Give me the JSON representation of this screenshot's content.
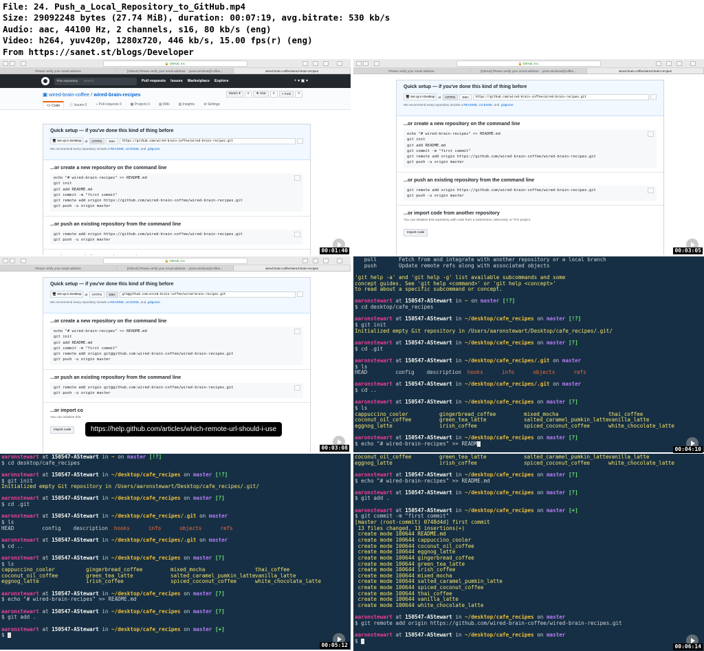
{
  "header": {
    "lines": [
      "File: 24. Push_a_Local_Repository_to_GitHub.mp4",
      "Size: 29092248 bytes (27.74 MiB), duration: 00:07:19, avg.bitrate: 530 kb/s",
      "Audio: aac, 44100 Hz, 2 channels, s16, 80 kb/s (eng)",
      "Video: h264, yuv420p, 1280x720, 446 kb/s, 15.00 fps(r) (eng)",
      "From https://sanet.st/blogs/Developer"
    ]
  },
  "timestamps": [
    "00:01:40",
    "00:03:05",
    "00:03:08",
    "00:04:10",
    "00:05:12",
    "00:06:14"
  ],
  "browser": {
    "address": "GitHub, Inc.",
    "tabs": [
      "Please verify your email address",
      "[GitHub] Please verify your email address. - jones.winslow@coffee...",
      "wired-brain-coffee/wired-brain-recipes"
    ],
    "nav": {
      "this_repo": "This repository",
      "search": "Search",
      "links": [
        "Pull requests",
        "Issues",
        "Marketplace",
        "Explore"
      ],
      "right": "+ ▾  ▣ ▾"
    },
    "repo": {
      "owner": "wired-brain-coffee",
      "sep": " / ",
      "name": "wired-brain-recipes",
      "watch": "Watch ▾",
      "watch_n": "0",
      "star": "★ Star",
      "star_n": "0",
      "fork": "⑂ Fork",
      "fork_n": "0"
    },
    "repo_tabs": [
      "<> Code",
      "ⓘ Issues 0",
      "⑂ Pull requests 0",
      "▦ Projects 0",
      "▤ Wiki",
      "▥ Insights",
      "⚙ Settings"
    ],
    "qs_title": "Quick setup — if you've done this kind of thing before",
    "setup_desktop": "🖥 Set up in Desktop",
    "or": "or",
    "https": "HTTPS",
    "ssh": "SSH",
    "url_https": "https://github.com/wired-brain-coffee/wired-brain-recipes.git",
    "url_ssh": "git@github.com:wired-brain-coffee/wired-brain-recipes.git",
    "recommend": [
      "We recommend every repository include a ",
      "README",
      ", ",
      "LICENSE",
      ", and ",
      ".gitignore",
      "."
    ],
    "create_title": "...or create a new repository on the command line",
    "create_https": [
      "echo \"# wired-brain-recipes\" >> README.md",
      "git init",
      "git add README.md",
      "git commit -m \"first commit\"",
      "git remote add origin https://github.com/wired-brain-coffee/wired-brain-recipes.git",
      "git push -u origin master"
    ],
    "create_ssh": [
      "echo \"# wired-brain-recipes\" >> README.md",
      "git init",
      "git add README.md",
      "git commit -m \"first commit\"",
      "git remote add origin git@github.com:wired-brain-coffee/wired-brain-recipes.git",
      "git push -u origin master"
    ],
    "push_title": "...or push an existing repository from the command line",
    "push_https": [
      "git remote add origin https://github.com/wired-brain-coffee/wired-brain-recipes.git",
      "git push -u origin master"
    ],
    "push_ssh": [
      "git remote add origin git@github.com:wired-brain-coffee/wired-brain-recipes.git",
      "git push -u origin master"
    ],
    "import_title": "...or import code from another repository",
    "import_title_cut": "...or import co",
    "import_desc": "You can initialize this repository with code from a Subversion, Mercurial, or TFS project.",
    "import_desc_cut": "You can initialize this",
    "import_btn": "Import code",
    "tooltip": "https://help.github.com/articles/which-remote-url-should-i-use"
  },
  "terminal": {
    "user": "aaronstewart",
    "at": " at ",
    "host": "150547-AStewart",
    "in": " in ",
    "on": " on ",
    "branch": "master",
    "help_pull": "   pull       Fetch from and integrate with another repository or a local branch",
    "help_push": "   push       Update remote refs along with associated objects",
    "help_tail": [
      "'git help -a' and 'git help -g' list available subcommands and some",
      "concept guides. See 'git help <command>' or 'git help <concept>'",
      "to read about a specific subcommand or concept."
    ],
    "init_out": "Initialized empty Git repository in /Users/aaronstewart/Desktop/cafe_recipes/.git/",
    "git_ls": [
      "HEAD",
      "config",
      "description",
      "hooks",
      "info",
      "objects",
      "refs"
    ],
    "ls_rows": [
      [
        "cappuccino_cooler",
        "gingerbread_coffee",
        "mixed_mocha",
        "thai_coffee"
      ],
      [
        "coconut_oil_coffee",
        "green_tea_latte",
        "salted_caramel_pumkin_latte",
        "vanilla_latte"
      ],
      [
        "eggnog_latte",
        "irish_coffee",
        "spiced_coconut_coffee",
        "white_chocolate_latte"
      ]
    ],
    "commit_out": [
      "[master (root-commit) 0748d4d] first commit",
      " 13 files changed, 13 insertions(+)",
      " create mode 100644 README.md",
      " create mode 100644 cappuccino_cooler",
      " create mode 100644 coconut_oil_coffee",
      " create mode 100644 eggnog_latte",
      " create mode 100644 gingerbread_coffee",
      " create mode 100644 green_tea_latte",
      " create mode 100644 irish_coffee",
      " create mode 100644 mixed_mocha",
      " create mode 100644 salted_caramel_pumkin_latte",
      " create mode 100644 spiced_coconut_coffee",
      " create mode 100644 thai_coffee",
      " create mode 100644 vanilla_latte",
      " create mode 100644 white_chocolate_latte"
    ]
  },
  "colors": {
    "terminal_bg": "#162f44",
    "user": "#ee3f96",
    "path": "#f0be37",
    "branch": "#b57cf5",
    "status": "#6ee66e",
    "gh_nav": "#24292e",
    "link": "#0366d6"
  }
}
